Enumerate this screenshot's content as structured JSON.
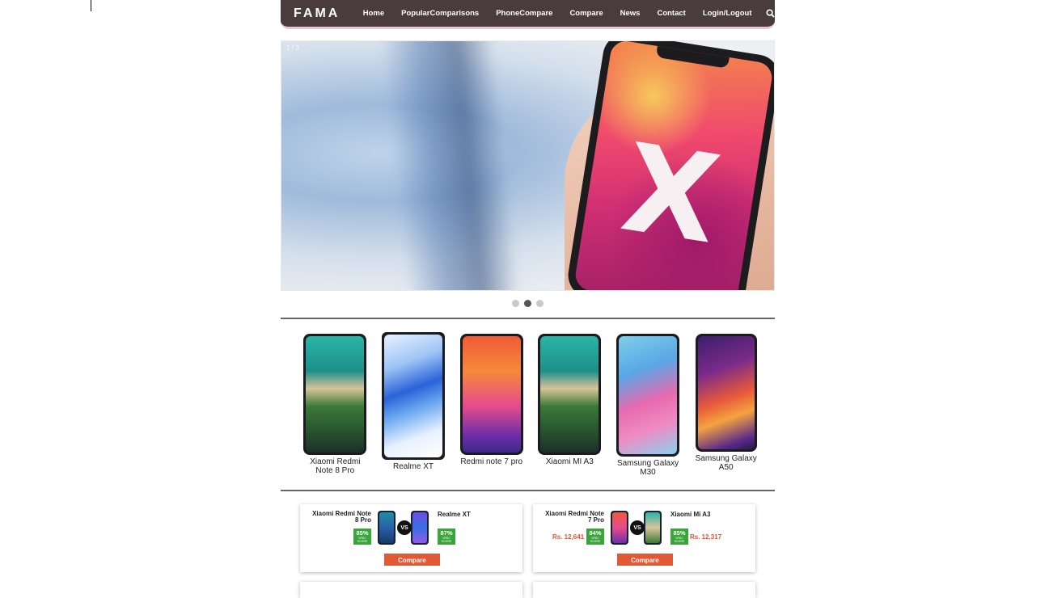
{
  "brand": "FAMA",
  "nav": {
    "items": [
      {
        "label": "Home"
      },
      {
        "label": "PopularComparisons"
      },
      {
        "label": "PhoneCompare"
      },
      {
        "label": "Compare"
      },
      {
        "label": "News"
      },
      {
        "label": "Contact"
      },
      {
        "label": "Login/Logout"
      }
    ],
    "search_icon": "search-icon"
  },
  "hero": {
    "counter": "1 / 3",
    "screen_letter": "X",
    "slides": 3,
    "active_slide": 2
  },
  "phones": [
    {
      "name": "Xiaomi Redmi Note 8 Pro"
    },
    {
      "name": "Realme XT"
    },
    {
      "name": "Redmi note 7 pro"
    },
    {
      "name": "Xiaomi MI A3"
    },
    {
      "name": "Samsung Galaxy M30"
    },
    {
      "name": "Samsung Galaxy A50"
    }
  ],
  "comparisons": [
    {
      "left": {
        "name": "Xiaomi Redmi Note 8 Pro",
        "score": "85%",
        "price": ""
      },
      "right": {
        "name": "Realme XT",
        "score": "87%",
        "price": ""
      },
      "vs": "VS",
      "score_caption": "SPEC SCORE",
      "button": "Compare"
    },
    {
      "left": {
        "name": "Xiaomi Redmi Note 7 Pro",
        "score": "84%",
        "price": "Rs. 12,641"
      },
      "right": {
        "name": "Xiaomi Mi A3",
        "score": "85%",
        "price": "Rs. 12,317"
      },
      "vs": "VS",
      "score_caption": "SPEC SCORE",
      "button": "Compare"
    }
  ],
  "colors": {
    "navbar": "#4a3b3e",
    "navbar_accent": "#e6c9cf",
    "compare_button": "#e25a34",
    "score_badge": "#3aa53a",
    "price": "#e0533b"
  }
}
